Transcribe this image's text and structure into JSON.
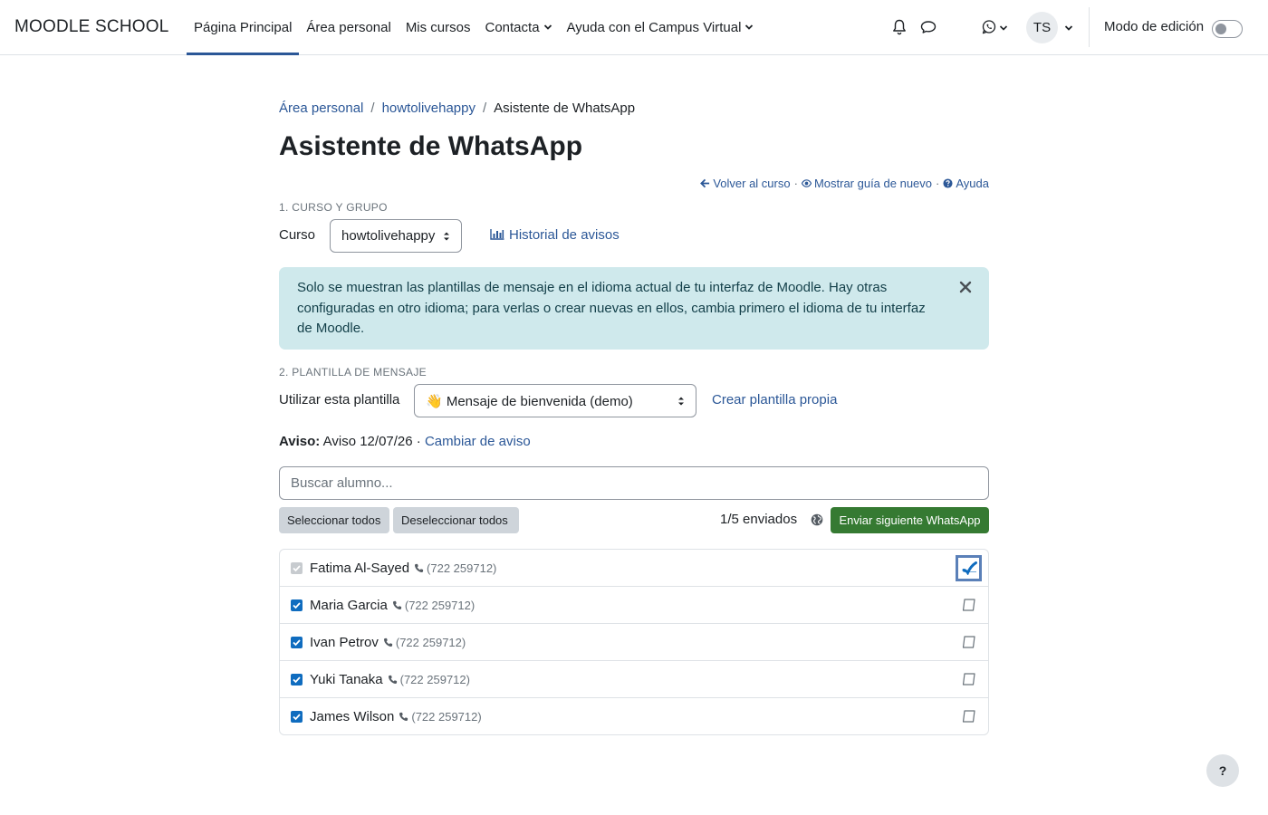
{
  "navbar": {
    "brand": "MOODLE SCHOOL",
    "items": [
      {
        "label": "Página Principal",
        "active": true,
        "dropdown": false
      },
      {
        "label": "Área personal",
        "active": false,
        "dropdown": false
      },
      {
        "label": "Mis cursos",
        "active": false,
        "dropdown": false
      },
      {
        "label": "Contacta",
        "active": false,
        "dropdown": true
      },
      {
        "label": "Ayuda con el Campus Virtual",
        "active": false,
        "dropdown": true
      }
    ],
    "avatar_initials": "TS",
    "edit_mode_label": "Modo de edición",
    "edit_mode_on": false,
    "icons": [
      "bell-icon",
      "chat-icon",
      "whatsapp-icon",
      "chevron-down-icon"
    ]
  },
  "breadcrumb": {
    "items": [
      "Área personal",
      "howtolivehappy",
      "Asistente de WhatsApp"
    ],
    "separator": "/"
  },
  "page": {
    "title": "Asistente de WhatsApp",
    "links": {
      "back": "Volver al curso",
      "guide": "Mostrar guía de nuevo",
      "help": "Ayuda"
    }
  },
  "section1": {
    "label": "1. CURSO Y GRUPO",
    "course_label": "Curso",
    "course_value": "howtolivehappy",
    "history_link": "Historial de avisos"
  },
  "alert": {
    "text": "Solo se muestran las plantillas de mensaje en el idioma actual de tu interfaz de Moodle. Hay otras configuradas en otro idioma; para verlas o crear nuevas en ellos, cambia primero el idioma de tu interfaz de Moodle."
  },
  "section2": {
    "label": "2. PLANTILLA DE MENSAJE",
    "template_label": "Utilizar esta plantilla",
    "template_value": "👋 Mensaje de bienvenida (demo)",
    "create_link": "Crear plantilla propia"
  },
  "aviso": {
    "label": "Aviso:",
    "value": "Aviso 12/07/26",
    "separator": "·",
    "change_link": "Cambiar de aviso"
  },
  "search": {
    "placeholder": "Buscar alumno...",
    "value": ""
  },
  "actions": {
    "select_all": "Seleccionar todos",
    "deselect_all": "Deseleccionar todos",
    "sent_count": "1/5 enviados",
    "send_next": "Enviar siguiente WhatsApp"
  },
  "students": [
    {
      "name": "Fatima Al-Sayed",
      "phone": "(722 259712)",
      "checked": true,
      "disabled": true,
      "sent": true
    },
    {
      "name": "Maria Garcia",
      "phone": "(722 259712)",
      "checked": true,
      "disabled": false,
      "sent": false
    },
    {
      "name": "Ivan Petrov",
      "phone": "(722 259712)",
      "checked": true,
      "disabled": false,
      "sent": false
    },
    {
      "name": "Yuki Tanaka",
      "phone": "(722 259712)",
      "checked": true,
      "disabled": false,
      "sent": false
    },
    {
      "name": "James Wilson",
      "phone": "(722 259712)",
      "checked": true,
      "disabled": false,
      "sent": false
    }
  ],
  "help_fab": "?",
  "colors": {
    "link": "#2b5797",
    "accent": "#0f6cbf",
    "success": "#357a32",
    "alert_bg": "#cfe9ec",
    "text": "#1d2125"
  }
}
